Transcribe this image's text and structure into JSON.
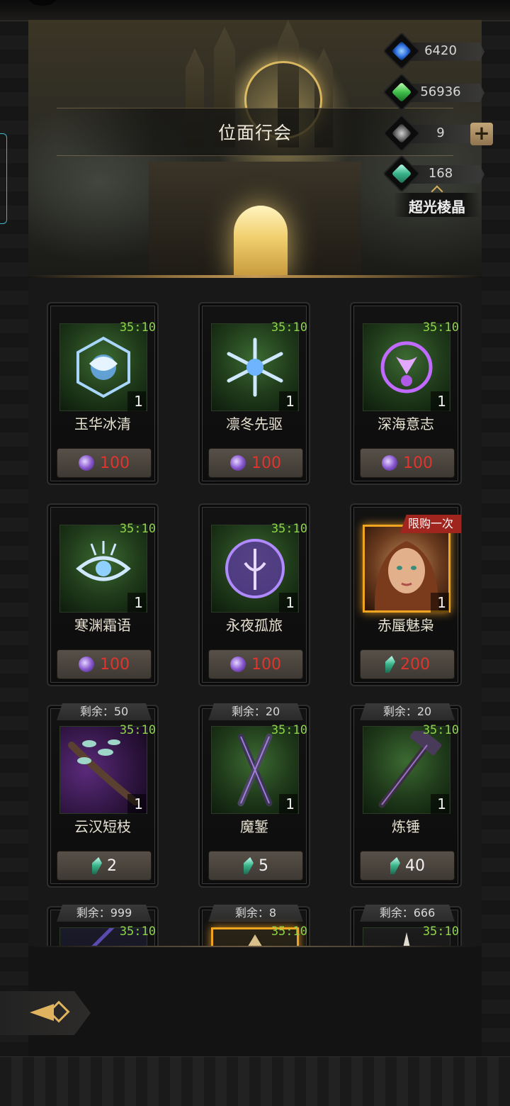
{
  "header": {
    "title": "位面行会"
  },
  "currencies": [
    {
      "name": "blue-flame",
      "value": "6420",
      "color": "#3a8cff"
    },
    {
      "name": "green-crystal",
      "value": "56936",
      "color": "#5ad46a"
    },
    {
      "name": "infinity",
      "value": "9",
      "color": "#9a9a9a"
    },
    {
      "name": "hyperlight-prism",
      "value": "168",
      "color": "#4ed0b0"
    }
  ],
  "currency_label": "超光棱晶",
  "items": [
    {
      "name": "玉华冰清",
      "timer": "35:10",
      "qty": "1",
      "price": "100",
      "currency": "purple-orb",
      "remaining": ""
    },
    {
      "name": "凛冬先驱",
      "timer": "35:10",
      "qty": "1",
      "price": "100",
      "currency": "purple-orb",
      "remaining": ""
    },
    {
      "name": "深海意志",
      "timer": "35:10",
      "qty": "1",
      "price": "100",
      "currency": "purple-orb",
      "remaining": ""
    },
    {
      "name": "寒渊霜语",
      "timer": "35:10",
      "qty": "1",
      "price": "100",
      "currency": "purple-orb",
      "remaining": ""
    },
    {
      "name": "永夜孤旅",
      "timer": "35:10",
      "qty": "1",
      "price": "100",
      "currency": "purple-orb",
      "remaining": ""
    },
    {
      "name": "赤蜃魅枭",
      "timer": "",
      "qty": "1",
      "price": "200",
      "currency": "prism",
      "remaining": "",
      "tag": "限购一次"
    },
    {
      "name": "云汉短枝",
      "timer": "35:10",
      "qty": "1",
      "price": "2",
      "currency": "prism",
      "remaining": "剩余：50"
    },
    {
      "name": "魔錾",
      "timer": "35:10",
      "qty": "1",
      "price": "5",
      "currency": "prism",
      "remaining": "剩余：20"
    },
    {
      "name": "炼锤",
      "timer": "35:10",
      "qty": "1",
      "price": "40",
      "currency": "prism",
      "remaining": "剩余：20"
    },
    {
      "name": "",
      "timer": "35:10",
      "qty": "",
      "price": "",
      "currency": "",
      "remaining": "剩余：999"
    },
    {
      "name": "",
      "timer": "35:10",
      "qty": "",
      "price": "",
      "currency": "",
      "remaining": "剩余：8"
    },
    {
      "name": "",
      "timer": "35:10",
      "qty": "",
      "price": "",
      "currency": "",
      "remaining": "剩余：666"
    }
  ],
  "colors": {
    "timer": "#8ed24a",
    "price_red": "#e0352e",
    "accent_gold": "#e0b45e"
  }
}
